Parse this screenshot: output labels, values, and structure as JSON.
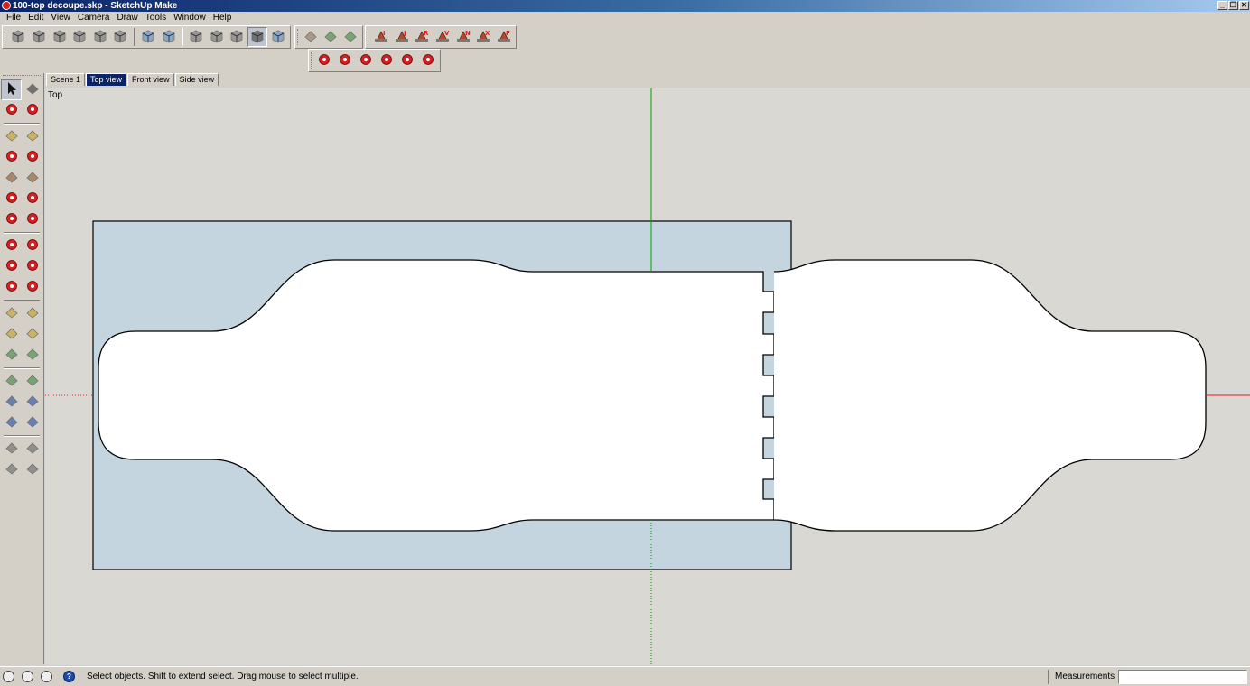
{
  "window": {
    "title": "100-top decoupe.skp - SketchUp Make",
    "controls": [
      "_",
      "❐",
      "✕"
    ]
  },
  "menu": [
    "File",
    "Edit",
    "View",
    "Camera",
    "Draw",
    "Tools",
    "Window",
    "Help"
  ],
  "toolbars": {
    "views_style": [
      {
        "name": "component-box-icon",
        "color": "#6a6a6a"
      },
      {
        "name": "book-icon",
        "color": "#6a6a6a"
      },
      {
        "name": "home-icon",
        "color": "#6a6a6a"
      },
      {
        "name": "warehouse-icon",
        "color": "#6a6a6a"
      },
      {
        "name": "house-outline-icon",
        "color": "#6a6a6a"
      },
      {
        "name": "shed-icon",
        "color": "#6a6a6a"
      },
      {
        "name": "xray-style-icon",
        "color": "#4a88c8"
      },
      {
        "name": "backedges-style-icon",
        "color": "#4a88c8"
      },
      {
        "name": "wireframe-style-icon",
        "color": "#6a6a6a"
      },
      {
        "name": "hiddenline-style-icon",
        "color": "#6a6a6a"
      },
      {
        "name": "shaded-style-icon",
        "color": "#6a6a6a"
      },
      {
        "name": "shaded-textures-style-icon",
        "color": "#303030"
      },
      {
        "name": "monochrome-style-icon",
        "color": "#4a88c8"
      }
    ],
    "sandbox": [
      {
        "name": "sandbox-contours-icon",
        "color": "#8a7a5a"
      },
      {
        "name": "sandbox-scratch-icon",
        "color": "#3a8a3a"
      },
      {
        "name": "sandbox-smoove-icon",
        "color": "#3a8a3a"
      }
    ],
    "standard_views": [
      {
        "name": "iso-view-icon",
        "glyph": "I"
      },
      {
        "name": "top-view-icon",
        "glyph": "J"
      },
      {
        "name": "front-view-icon",
        "glyph": "R"
      },
      {
        "name": "right-view-icon",
        "glyph": "V"
      },
      {
        "name": "back-view-icon",
        "glyph": "N"
      },
      {
        "name": "left-view-icon",
        "glyph": "X"
      },
      {
        "name": "bottom-view-icon",
        "glyph": "F"
      }
    ],
    "edit": [
      {
        "name": "move-icon",
        "color": "#d42020"
      },
      {
        "name": "pushpull-icon",
        "color": "#d42020"
      },
      {
        "name": "rotate-icon",
        "color": "#d42020"
      },
      {
        "name": "followme-icon",
        "color": "#d42020"
      },
      {
        "name": "scale-icon",
        "color": "#d42020"
      },
      {
        "name": "offset-icon",
        "color": "#d42020"
      }
    ]
  },
  "left_tools": [
    [
      "select-icon",
      "make-component-icon"
    ],
    [
      "paint-bucket-icon",
      "eraser-icon"
    ],
    [
      "pencil-line-icon",
      "freehand-icon"
    ],
    [
      "rectangle-icon",
      "rotated-rectangle-icon"
    ],
    [
      "circle-icon",
      "polygon-icon"
    ],
    [
      "arc-icon",
      "two-point-arc-icon"
    ],
    [
      "three-point-arc-icon",
      "pie-icon"
    ],
    [
      "move-tool-icon",
      "pushpull-tool-icon"
    ],
    [
      "rotate-tool-icon",
      "followme-tool-icon"
    ],
    [
      "scale-tool-icon",
      "offset-tool-icon"
    ],
    [
      "tape-measure-icon",
      "dimensions-icon"
    ],
    [
      "protractor-icon",
      "text-icon"
    ],
    [
      "axes-icon",
      "3d-text-icon"
    ],
    [
      "orbit-icon",
      "pan-icon"
    ],
    [
      "zoom-icon",
      "zoom-window-icon"
    ],
    [
      "zoom-extents-icon",
      "previous-view-icon"
    ],
    [
      "walk-icon",
      "look-around-icon"
    ],
    [
      "footprints-icon",
      "position-camera-icon"
    ]
  ],
  "scene_tabs": [
    {
      "label": "Scene 1",
      "active": false
    },
    {
      "label": "Top view",
      "active": true
    },
    {
      "label": "Front view",
      "active": false
    },
    {
      "label": "Side view",
      "active": false
    }
  ],
  "viewport": {
    "label": "Top",
    "colors": {
      "background": "#d9d8d3",
      "panel_fill": "#c5d5df",
      "shape_fill": "#ffffff",
      "outline": "#000000",
      "axis_green": "#00a000",
      "axis_red": "#e02020"
    }
  },
  "status": {
    "icons": [
      "geolocation-icon",
      "credits-icon",
      "user-icon",
      "help-icon"
    ],
    "help_glyph": "?",
    "text": "Select objects. Shift to extend select. Drag mouse to select multiple.",
    "measurements_label": "Measurements",
    "measurements_value": ""
  }
}
